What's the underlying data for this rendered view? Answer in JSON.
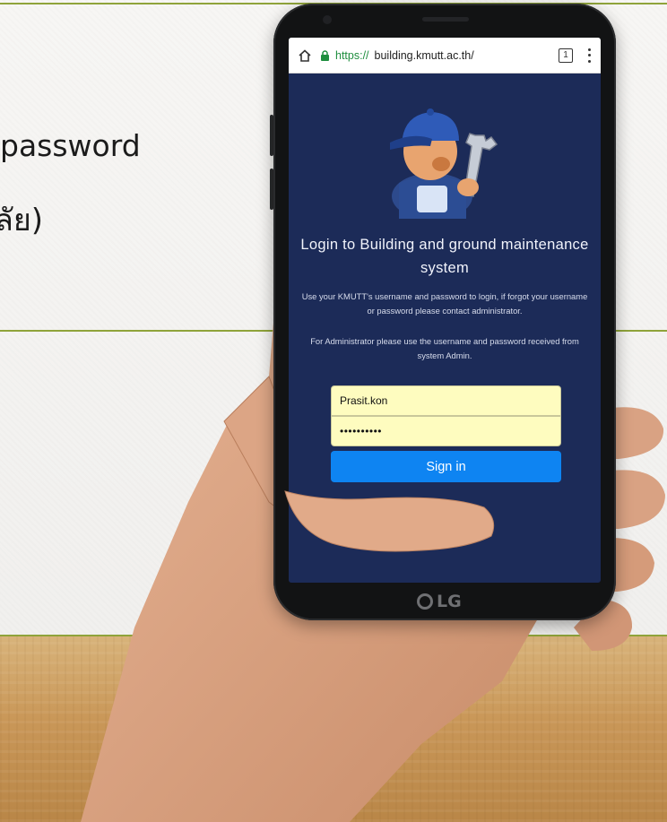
{
  "slide": {
    "line1": "password",
    "line2": "ลัย)",
    "accent_color": "#8fa33a"
  },
  "browser": {
    "home_icon": "home-icon",
    "lock_icon": "lock-icon",
    "url_scheme": "https://",
    "url_host": "building.kmutt.ac.th/",
    "tab_count": "1",
    "menu_icon": "overflow-menu-icon"
  },
  "login": {
    "mascot_icon": "maintenance-worker-icon",
    "title": "Login to Building and ground maintenance system",
    "info_user": "Use your KMUTT's username and password to login, if forgot your username or password please contact administrator.",
    "info_admin": "For Administrator please use the username and password received from system Admin.",
    "username_value": "Prasit.kon",
    "password_value": "••••••••••",
    "signin_label": "Sign in",
    "button_color": "#0e84f2",
    "field_color": "#fefcbf",
    "screen_color": "#1c2b58"
  },
  "device": {
    "brand": "LG"
  }
}
